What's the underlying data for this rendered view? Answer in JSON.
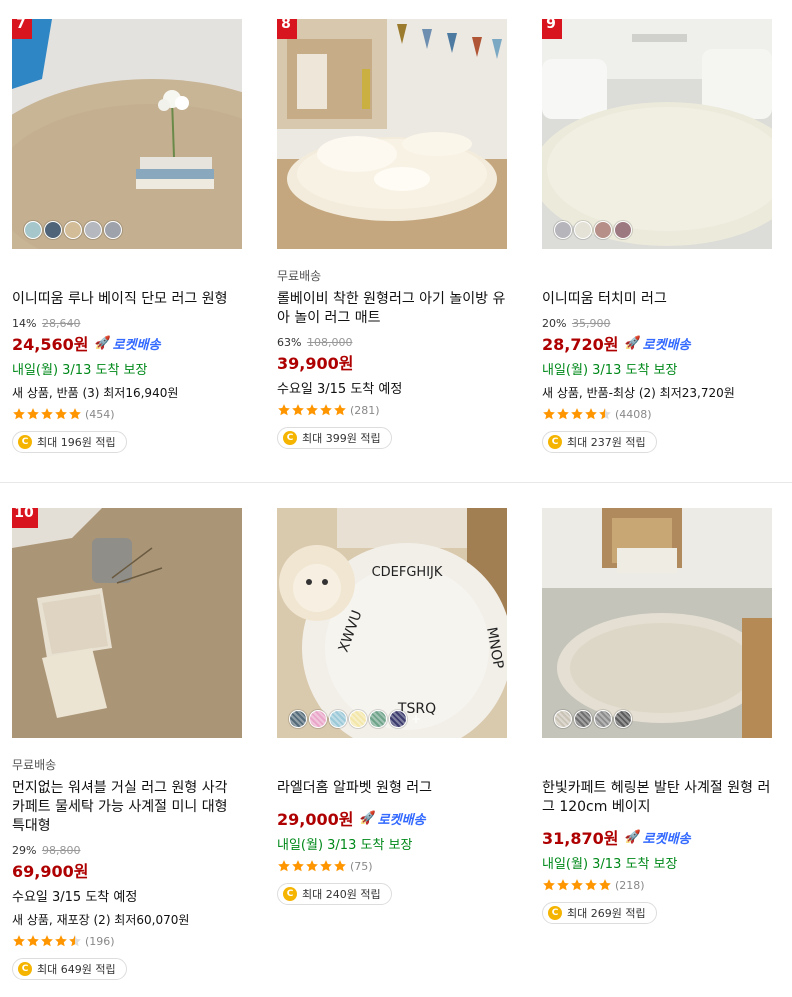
{
  "products": [
    {
      "rank": "7",
      "free_shipping": "",
      "name": "이니띠움 루나 베이직 단모 러그 원형",
      "discount": "14%",
      "original_price": "28,640",
      "price": "24,560원",
      "rocket": "로켓배송",
      "delivery": "내일(월) 3/13 도착 보장",
      "other_sellers": "새 상품, 반품 (3) 최저16,940원",
      "rating": 5,
      "review_count": "(454)",
      "reward": "최대 196원 적립",
      "swatch_colors": [
        "#a5c7cc",
        "#4f6478",
        "#d2bd98",
        "#b5b8bf",
        "#9ea2ab"
      ]
    },
    {
      "rank": "8",
      "free_shipping": "무료배송",
      "name": "롤베이비 착한 원형러그 아기 놀이방 유아 놀이 러그 매트",
      "discount": "63%",
      "original_price": "108,000",
      "price": "39,900원",
      "rocket": "",
      "delivery": "수요일 3/15 도착 예정",
      "other_sellers": "",
      "rating": 5,
      "review_count": "(281)",
      "reward": "최대 399원 적립",
      "swatch_colors": []
    },
    {
      "rank": "9",
      "free_shipping": "",
      "name": "이니띠움 터치미 러그",
      "discount": "20%",
      "original_price": "35,900",
      "price": "28,720원",
      "rocket": "로켓배송",
      "delivery": "내일(월) 3/13 도착 보장",
      "other_sellers": "새 상품, 반품-최상 (2) 최저23,720원",
      "rating": 4.5,
      "review_count": "(4408)",
      "reward": "최대 237원 적립",
      "swatch_colors": [
        "#b5b5bb",
        "#e4e1d6",
        "#b58f88",
        "#9c7880"
      ]
    },
    {
      "rank": "10",
      "free_shipping": "무료배송",
      "name": "먼지없는 워셔블 거실 러그 원형 사각 카페트 물세탁 가능 사계절 미니 대형 특대형",
      "discount": "29%",
      "original_price": "98,800",
      "price": "69,900원",
      "rocket": "",
      "delivery": "수요일 3/15 도착 예정",
      "other_sellers": "새 상품, 재포장 (2) 최저60,070원",
      "rating": 4.5,
      "review_count": "(196)",
      "reward": "최대 649원 적립",
      "swatch_colors": []
    },
    {
      "rank": "",
      "free_shipping": "",
      "name": "라엘더홈 알파벳 원형 러그",
      "discount": "",
      "original_price": "",
      "price": "29,000원",
      "rocket": "로켓배송",
      "delivery": "내일(월) 3/13 도착 보장",
      "other_sellers": "",
      "rating": 5,
      "review_count": "(75)",
      "reward": "최대 240원 적립",
      "swatch_colors": [
        "#556b7a",
        "#e9a6c8",
        "#9cc9d8",
        "#f3e6a9",
        "#6fa38a",
        "#3c3c6e"
      ],
      "swatch_more": "+"
    },
    {
      "rank": "",
      "free_shipping": "",
      "name": "한빛카페트 헤링본 발탄 사계절 원형 러그 120cm 베이지",
      "discount": "",
      "original_price": "",
      "price": "31,870원",
      "rocket": "로켓배송",
      "delivery": "내일(월) 3/13 도착 보장",
      "other_sellers": "",
      "rating": 5,
      "review_count": "(218)",
      "reward": "최대 269원 적립",
      "swatch_colors": [
        "#c9c3b6",
        "#6f6f6f",
        "#8c8c8c",
        "#5c5c5c"
      ]
    }
  ],
  "colors": {
    "price": "#ae0000",
    "rocket": "#346aff",
    "delivery_guaranteed": "#00891a",
    "rank_badge": "#d8141e",
    "star": "#ff9600",
    "coin": "#f5b400"
  }
}
